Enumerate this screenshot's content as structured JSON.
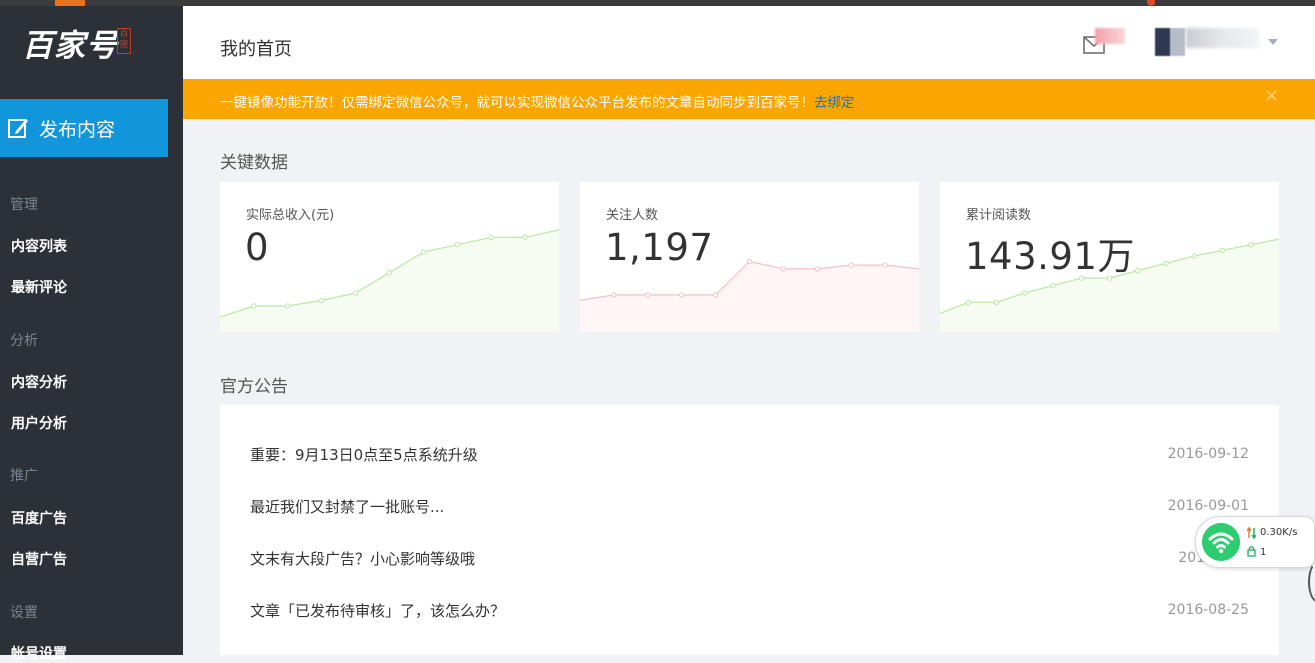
{
  "brand": {
    "name": "百家号",
    "seal": "百度"
  },
  "sidebar": {
    "publish_label": "发布内容",
    "sections": [
      {
        "label": "管理",
        "items": [
          "内容列表",
          "最新评论"
        ]
      },
      {
        "label": "分析",
        "items": [
          "内容分析",
          "用户分析"
        ]
      },
      {
        "label": "推广",
        "items": [
          "百度广告",
          "自营广告"
        ]
      },
      {
        "label": "设置",
        "items": [
          "帐号设置"
        ]
      }
    ]
  },
  "header": {
    "title": "我的首页"
  },
  "notice": {
    "text": "一键镜像功能开放！仅需绑定微信公众号，就可以实现微信公众平台发布的文章自动同步到百家号！",
    "link": "去绑定",
    "close": "×"
  },
  "key_data": {
    "title": "关键数据",
    "cards": [
      {
        "label": "实际总收入(元)",
        "value": "0",
        "color": "#b9e8a3",
        "fill": "#f6fcf2",
        "points": [
          8,
          14,
          14,
          17,
          21,
          32,
          43,
          47,
          51,
          51,
          55
        ]
      },
      {
        "label": "关注人数",
        "value": "1,197",
        "color": "#f5c0c6",
        "fill": "#fdf5f6",
        "points": [
          17,
          20,
          20,
          20,
          20,
          38,
          34,
          34,
          36,
          36,
          34
        ]
      },
      {
        "label": "累计阅读数",
        "value": "143.91万",
        "color": "#b9e8a3",
        "fill": "#f6fcf2",
        "points": [
          10,
          16,
          16,
          21,
          25,
          29,
          29,
          33,
          37,
          41,
          44,
          47,
          50
        ]
      }
    ]
  },
  "announcements": {
    "title": "官方公告",
    "items": [
      {
        "title": "重要：9月13日0点至5点系统升级",
        "date": "2016-09-12"
      },
      {
        "title": "最近我们又封禁了一批账号...",
        "date": "2016-09-01"
      },
      {
        "title": "文末有大段广告？小心影响等级哦",
        "date": "2016-"
      },
      {
        "title": "文章「已发布待审核」了，该怎么办？",
        "date": "2016-08-25"
      }
    ]
  },
  "network_widget": {
    "speed": "0.30K/s",
    "connections": "1"
  }
}
